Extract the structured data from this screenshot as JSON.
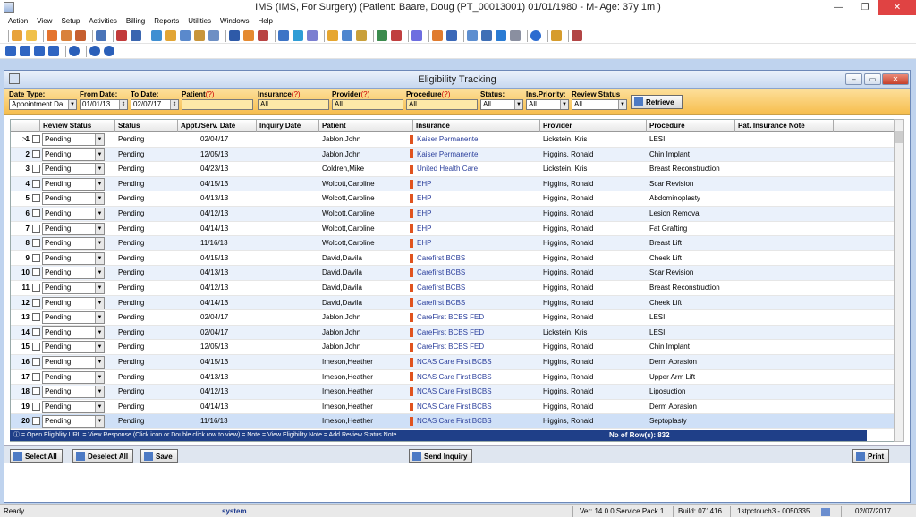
{
  "window": {
    "title": "IMS (IMS, For Surgery)    (Patient: Baare, Doug  (PT_00013001) 01/01/1980 - M- Age: 37y 1m )"
  },
  "menu": [
    "Action",
    "View",
    "Setup",
    "Activities",
    "Billing",
    "Reports",
    "Utilities",
    "Windows",
    "Help"
  ],
  "child": {
    "title": "Eligibility Tracking"
  },
  "filters": {
    "date_type_label": "Date Type:",
    "date_type_value": "Appointment Da",
    "from_label": "From Date:",
    "from_value": "01/01/13",
    "to_label": "To Date:",
    "to_value": "02/07/17",
    "patient_label": "Patient",
    "insurance_label": "Insurance",
    "provider_label": "Provider",
    "procedure_label": "Procedure",
    "q": "(?)",
    "insurance_value": "All",
    "provider_value": "All",
    "procedure_value": "All",
    "status_label": "Status:",
    "status_value": "All",
    "priority_label": "Ins.Priority:",
    "priority_value": "All",
    "review_label": "Review Status",
    "review_value": "All",
    "retrieve": "Retrieve"
  },
  "columns": [
    "Review Status",
    "Status",
    "Appt./Serv. Date",
    "Inquiry Date",
    "Patient",
    "Insurance",
    "Provider",
    "Procedure",
    "Pat. Insurance Note"
  ],
  "rows": [
    {
      "n": "1",
      "review": "Pending",
      "status": "Pending",
      "date": "02/04/17",
      "patient": "Jablon,John",
      "insurance": "Kaiser Permanente",
      "provider": "Lickstein, Kris",
      "procedure": "LESI"
    },
    {
      "n": "2",
      "review": "Pending",
      "status": "Pending",
      "date": "12/05/13",
      "patient": "Jablon,John",
      "insurance": "Kaiser Permanente",
      "provider": "Higgins, Ronald",
      "procedure": "Chin Implant"
    },
    {
      "n": "3",
      "review": "Pending",
      "status": "Pending",
      "date": "04/23/13",
      "patient": "Coldren,Mike",
      "insurance": "United Health Care",
      "provider": "Lickstein, Kris",
      "procedure": "Breast Reconstruction"
    },
    {
      "n": "4",
      "review": "Pending",
      "status": "Pending",
      "date": "04/15/13",
      "patient": "Wolcott,Caroline",
      "insurance": "EHP",
      "provider": "Higgins, Ronald",
      "procedure": "Scar Revision"
    },
    {
      "n": "5",
      "review": "Pending",
      "status": "Pending",
      "date": "04/13/13",
      "patient": "Wolcott,Caroline",
      "insurance": "EHP",
      "provider": "Higgins, Ronald",
      "procedure": "Abdominoplasty"
    },
    {
      "n": "6",
      "review": "Pending",
      "status": "Pending",
      "date": "04/12/13",
      "patient": "Wolcott,Caroline",
      "insurance": "EHP",
      "provider": "Higgins, Ronald",
      "procedure": "Lesion Removal"
    },
    {
      "n": "7",
      "review": "Pending",
      "status": "Pending",
      "date": "04/14/13",
      "patient": "Wolcott,Caroline",
      "insurance": "EHP",
      "provider": "Higgins, Ronald",
      "procedure": "Fat Grafting"
    },
    {
      "n": "8",
      "review": "Pending",
      "status": "Pending",
      "date": "11/16/13",
      "patient": "Wolcott,Caroline",
      "insurance": "EHP",
      "provider": "Higgins, Ronald",
      "procedure": "Breast Lift"
    },
    {
      "n": "9",
      "review": "Pending",
      "status": "Pending",
      "date": "04/15/13",
      "patient": "David,Davila",
      "insurance": "Carefirst BCBS",
      "provider": "Higgins, Ronald",
      "procedure": "Cheek Lift"
    },
    {
      "n": "10",
      "review": "Pending",
      "status": "Pending",
      "date": "04/13/13",
      "patient": "David,Davila",
      "insurance": "Carefirst BCBS",
      "provider": "Higgins, Ronald",
      "procedure": "Scar Revision"
    },
    {
      "n": "11",
      "review": "Pending",
      "status": "Pending",
      "date": "04/12/13",
      "patient": "David,Davila",
      "insurance": "Carefirst BCBS",
      "provider": "Higgins, Ronald",
      "procedure": "Breast Reconstruction"
    },
    {
      "n": "12",
      "review": "Pending",
      "status": "Pending",
      "date": "04/14/13",
      "patient": "David,Davila",
      "insurance": "Carefirst BCBS",
      "provider": "Higgins, Ronald",
      "procedure": "Cheek Lift"
    },
    {
      "n": "13",
      "review": "Pending",
      "status": "Pending",
      "date": "02/04/17",
      "patient": "Jablon,John",
      "insurance": "CareFirst BCBS FED",
      "provider": "Higgins, Ronald",
      "procedure": "LESI"
    },
    {
      "n": "14",
      "review": "Pending",
      "status": "Pending",
      "date": "02/04/17",
      "patient": "Jablon,John",
      "insurance": "CareFirst BCBS FED",
      "provider": "Lickstein, Kris",
      "procedure": "LESI"
    },
    {
      "n": "15",
      "review": "Pending",
      "status": "Pending",
      "date": "12/05/13",
      "patient": "Jablon,John",
      "insurance": "CareFirst BCBS FED",
      "provider": "Higgins, Ronald",
      "procedure": "Chin Implant"
    },
    {
      "n": "16",
      "review": "Pending",
      "status": "Pending",
      "date": "04/15/13",
      "patient": "Imeson,Heather",
      "insurance": "NCAS Care First BCBS",
      "provider": "Higgins, Ronald",
      "procedure": "Derm Abrasion"
    },
    {
      "n": "17",
      "review": "Pending",
      "status": "Pending",
      "date": "04/13/13",
      "patient": "Imeson,Heather",
      "insurance": "NCAS Care First BCBS",
      "provider": "Higgins, Ronald",
      "procedure": "Upper Arm Lift"
    },
    {
      "n": "18",
      "review": "Pending",
      "status": "Pending",
      "date": "04/12/13",
      "patient": "Imeson,Heather",
      "insurance": "NCAS Care First BCBS",
      "provider": "Higgins, Ronald",
      "procedure": "Liposuction"
    },
    {
      "n": "19",
      "review": "Pending",
      "status": "Pending",
      "date": "04/14/13",
      "patient": "Imeson,Heather",
      "insurance": "NCAS Care First BCBS",
      "provider": "Higgins, Ronald",
      "procedure": "Derm Abrasion"
    },
    {
      "n": "20",
      "review": "Pending",
      "status": "Pending",
      "date": "11/16/13",
      "patient": "Imeson,Heather",
      "insurance": "NCAS Care First BCBS",
      "provider": "Higgins, Ronald",
      "procedure": "Septoplasty"
    }
  ],
  "legend": {
    "text": "= Open Eligiblity URL    = View Response (Click icon or Double click row to view)      = Note      = View Eligibility Note     = Add Review Status Note",
    "count": "No of Row(s): 832"
  },
  "buttons": {
    "select_all": "Select All",
    "deselect_all": "Deselect All",
    "save": "Save",
    "send_inquiry": "Send Inquiry",
    "print": "Print"
  },
  "status": {
    "ready": "Ready",
    "user": "system",
    "version": "Ver: 14.0.0 Service Pack 1",
    "build": "Build: 071416",
    "server": "1stpctouch3 - 0050335",
    "date": "02/07/2017"
  },
  "colors": {
    "accent": "#1f3f88",
    "filter_bg": "#f6bd4c",
    "close": "#e04343"
  }
}
